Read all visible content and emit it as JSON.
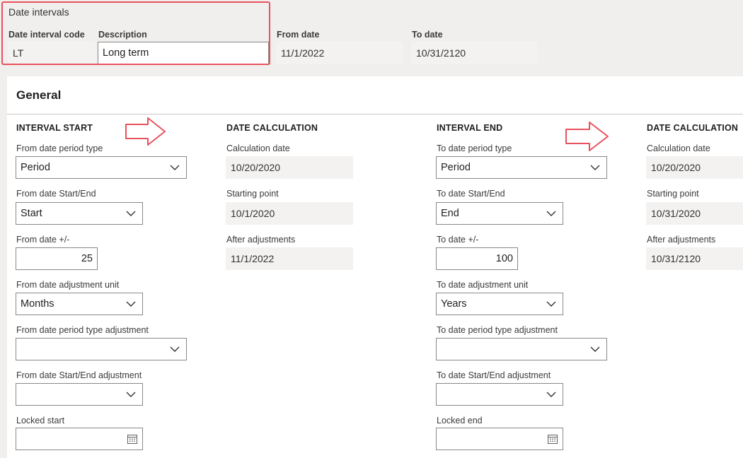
{
  "header": {
    "group_title": "Date intervals",
    "code_label": "Date interval code",
    "code_value": "LT",
    "description_label": "Description",
    "description_value": "Long term",
    "from_label": "From date",
    "from_value": "11/1/2022",
    "to_label": "To date",
    "to_value": "10/31/2120"
  },
  "general": {
    "title": "General",
    "interval_start": {
      "heading": "INTERVAL START",
      "period_type_label": "From date period type",
      "period_type_value": "Period",
      "start_end_label": "From date Start/End",
      "start_end_value": "Start",
      "plus_minus_label": "From date +/-",
      "plus_minus_value": "25",
      "adj_unit_label": "From date adjustment unit",
      "adj_unit_value": "Months",
      "period_type_adj_label": "From date period type adjustment",
      "period_type_adj_value": "",
      "start_end_adj_label": "From date Start/End adjustment",
      "start_end_adj_value": "",
      "locked_label": "Locked start",
      "locked_value": ""
    },
    "start_calc": {
      "heading": "DATE CALCULATION",
      "calc_date_label": "Calculation date",
      "calc_date_value": "10/20/2020",
      "starting_point_label": "Starting point",
      "starting_point_value": "10/1/2020",
      "after_adj_label": "After adjustments",
      "after_adj_value": "11/1/2022"
    },
    "interval_end": {
      "heading": "INTERVAL END",
      "period_type_label": "To date period type",
      "period_type_value": "Period",
      "start_end_label": "To date Start/End",
      "start_end_value": "End",
      "plus_minus_label": "To date +/-",
      "plus_minus_value": "100",
      "adj_unit_label": "To date adjustment unit",
      "adj_unit_value": "Years",
      "period_type_adj_label": "To date period type adjustment",
      "period_type_adj_value": "",
      "start_end_adj_label": "To date Start/End adjustment",
      "start_end_adj_value": "",
      "locked_label": "Locked end",
      "locked_value": ""
    },
    "end_calc": {
      "heading": "DATE CALCULATION",
      "calc_date_label": "Calculation date",
      "calc_date_value": "10/20/2020",
      "starting_point_label": "Starting point",
      "starting_point_value": "10/31/2020",
      "after_adj_label": "After adjustments",
      "after_adj_value": "10/31/2120"
    }
  },
  "icons": {
    "dropdown": "chevron-down-icon",
    "calendar": "calendar-icon",
    "annotation": "arrow-right-icon"
  },
  "colors": {
    "annotation": "#e8525c",
    "field_border": "#8a8886",
    "readonly_bg": "#f3f2f1"
  }
}
